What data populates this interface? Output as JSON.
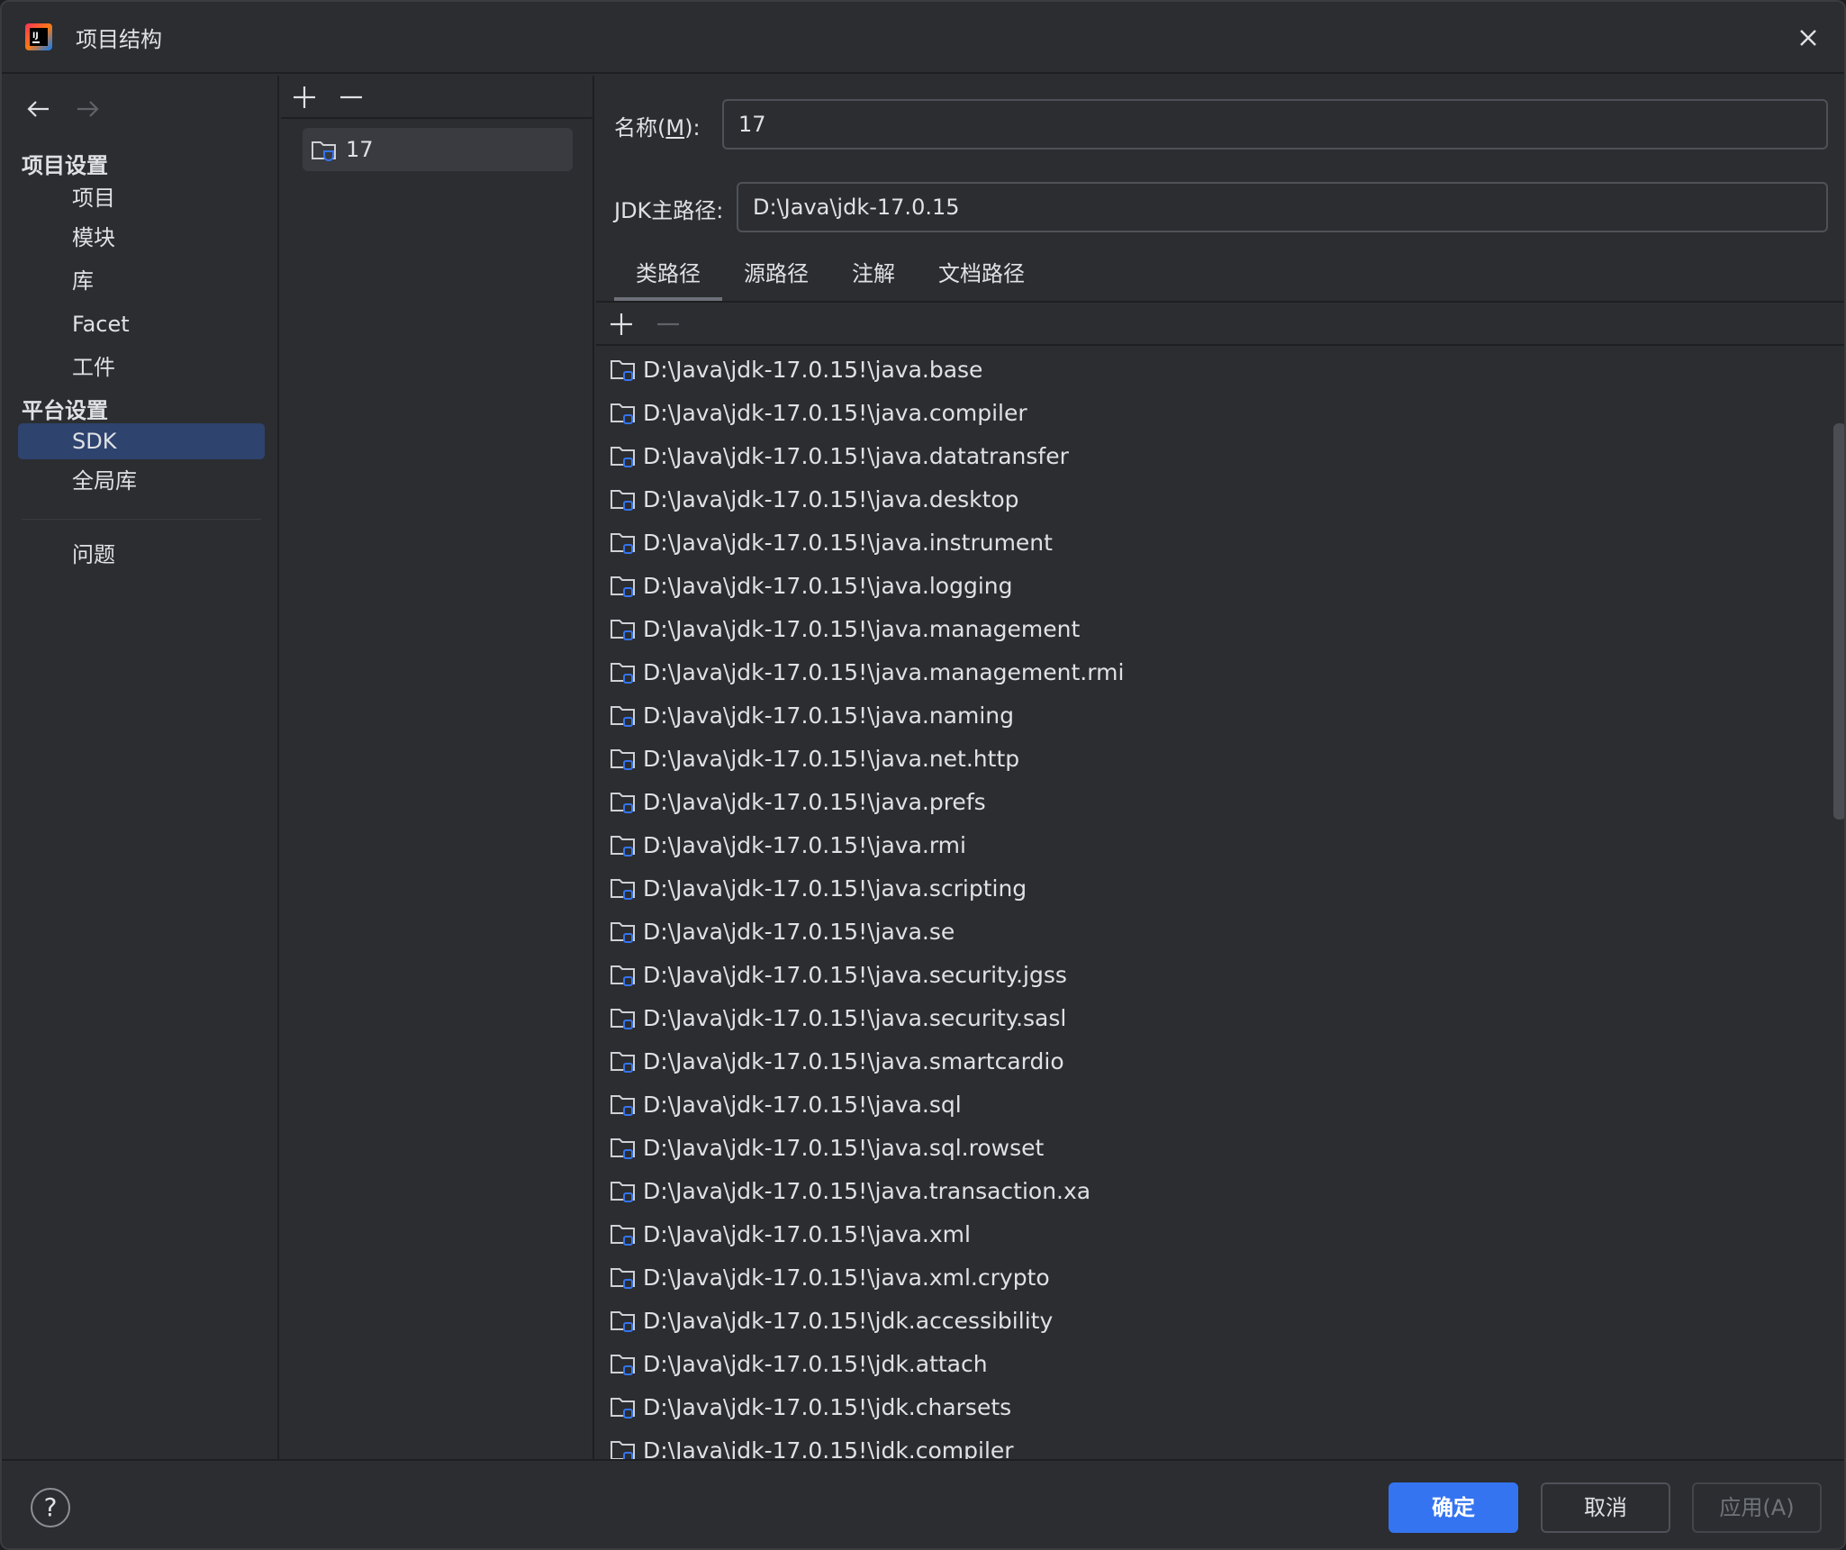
{
  "window": {
    "title": "项目结构"
  },
  "nav": {
    "project_settings_header": "项目设置",
    "project_items": [
      "项目",
      "模块",
      "库",
      "Facet",
      "工件"
    ],
    "platform_settings_header": "平台设置",
    "platform_items": [
      "SDK",
      "全局库"
    ],
    "selected": "SDK",
    "problems": "问题"
  },
  "sdk_list": {
    "entries": [
      "17"
    ]
  },
  "detail": {
    "name_label_prefix": "名称(",
    "name_label_mnemonic": "M",
    "name_label_suffix": "):",
    "name_value": "17",
    "jdk_home_label": "JDK主路径:",
    "jdk_home_value": "D:\\Java\\jdk-17.0.15",
    "tabs": [
      "类路径",
      "源路径",
      "注解",
      "文档路径"
    ],
    "active_tab": "类路径",
    "classpath": [
      "D:\\Java\\jdk-17.0.15!\\java.base",
      "D:\\Java\\jdk-17.0.15!\\java.compiler",
      "D:\\Java\\jdk-17.0.15!\\java.datatransfer",
      "D:\\Java\\jdk-17.0.15!\\java.desktop",
      "D:\\Java\\jdk-17.0.15!\\java.instrument",
      "D:\\Java\\jdk-17.0.15!\\java.logging",
      "D:\\Java\\jdk-17.0.15!\\java.management",
      "D:\\Java\\jdk-17.0.15!\\java.management.rmi",
      "D:\\Java\\jdk-17.0.15!\\java.naming",
      "D:\\Java\\jdk-17.0.15!\\java.net.http",
      "D:\\Java\\jdk-17.0.15!\\java.prefs",
      "D:\\Java\\jdk-17.0.15!\\java.rmi",
      "D:\\Java\\jdk-17.0.15!\\java.scripting",
      "D:\\Java\\jdk-17.0.15!\\java.se",
      "D:\\Java\\jdk-17.0.15!\\java.security.jgss",
      "D:\\Java\\jdk-17.0.15!\\java.security.sasl",
      "D:\\Java\\jdk-17.0.15!\\java.smartcardio",
      "D:\\Java\\jdk-17.0.15!\\java.sql",
      "D:\\Java\\jdk-17.0.15!\\java.sql.rowset",
      "D:\\Java\\jdk-17.0.15!\\java.transaction.xa",
      "D:\\Java\\jdk-17.0.15!\\java.xml",
      "D:\\Java\\jdk-17.0.15!\\java.xml.crypto",
      "D:\\Java\\jdk-17.0.15!\\jdk.accessibility",
      "D:\\Java\\jdk-17.0.15!\\jdk.attach",
      "D:\\Java\\jdk-17.0.15!\\jdk.charsets",
      "D:\\Java\\jdk-17.0.15!\\jdk.compiler"
    ]
  },
  "footer": {
    "help": "?",
    "ok": "确定",
    "cancel": "取消",
    "apply": "应用(A)"
  },
  "colors": {
    "accent": "#3574f0",
    "selection": "#2e436e",
    "folder_badge": "#3574f0"
  },
  "icons": [
    "app-logo-icon",
    "close-icon",
    "arrow-left-icon",
    "arrow-right-icon",
    "add-icon",
    "remove-icon",
    "sdk-folder-icon",
    "library-folder-icon"
  ]
}
